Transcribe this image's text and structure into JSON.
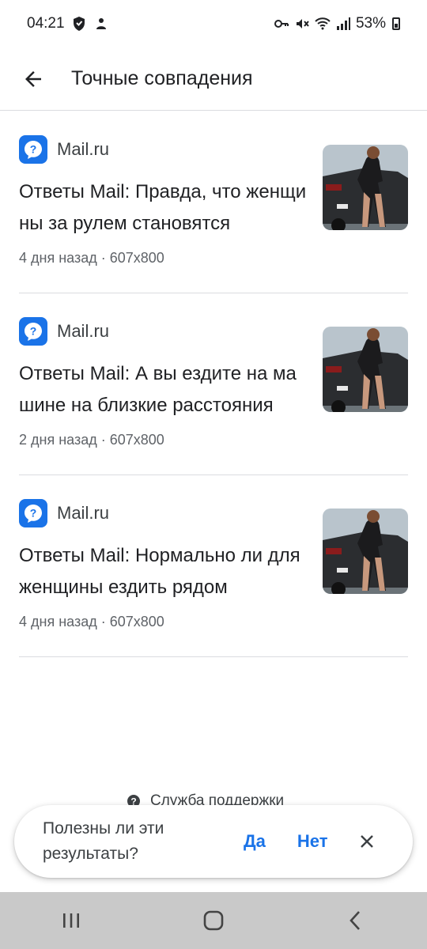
{
  "status_bar": {
    "time": "04:21",
    "battery": "53%",
    "icons": [
      "shield-icon",
      "person-icon",
      "key-icon",
      "mute-icon",
      "wifi-icon",
      "signal-icon",
      "battery-icon"
    ]
  },
  "app_bar": {
    "title": "Точные совпадения",
    "back_icon": "arrow-back-icon"
  },
  "results": [
    {
      "source": "Mail.ru",
      "title": "Ответы Mail: Правда, что женщины за рулем становятся",
      "meta": "4 дня назад · 607x800"
    },
    {
      "source": "Mail.ru",
      "title": "Ответы Mail: А вы ездите на машине на близкие расстояния",
      "meta": "2 дня назад · 607x800"
    },
    {
      "source": "Mail.ru",
      "title": "Ответы Mail: Нормально ли для женщины ездить рядом",
      "meta": "4 дня назад · 607x800"
    }
  ],
  "support": {
    "label": "Служба поддержки"
  },
  "feedback": {
    "question": "Полезны ли эти результаты?",
    "yes": "Да",
    "no": "Нет"
  },
  "colors": {
    "accent": "#1a73e8",
    "nav_bar": "#c9c9c9"
  }
}
